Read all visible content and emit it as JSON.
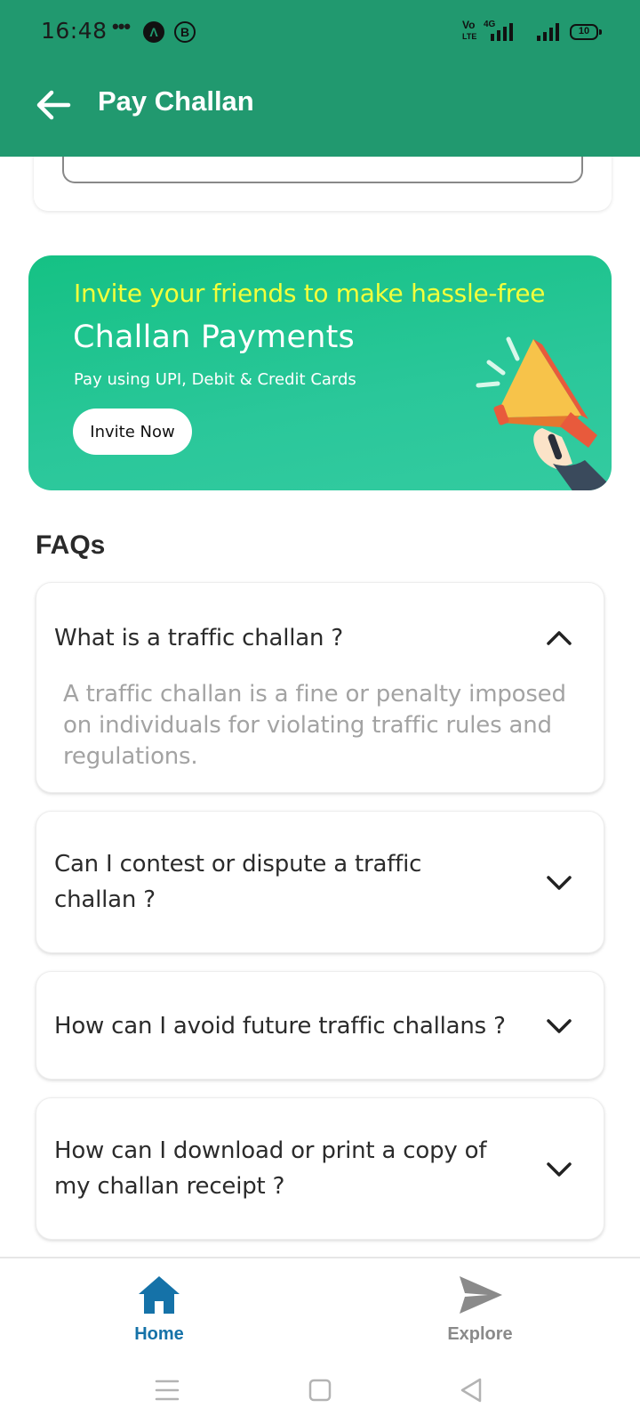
{
  "status_bar": {
    "time": "16:48",
    "dots": "•••",
    "badge_a": "Λ",
    "badge_b": "B",
    "network_1": "Vo",
    "network_2": "LTE",
    "network_3": "4G",
    "battery": "10"
  },
  "app_bar": {
    "title": "Pay Challan",
    "back_icon": "arrow-left-icon",
    "bg_color": "#21996f"
  },
  "promo": {
    "line1": "Invite your friends to make hassle-free",
    "line2": "Challan Payments",
    "line3": "Pay using UPI, Debit & Credit Cards",
    "button_label": "Invite Now",
    "illustration": "megaphone-icon"
  },
  "faqs": {
    "heading": "FAQs",
    "items": [
      {
        "question": "What is a traffic challan ?",
        "answer": "A traffic challan is a fine or penalty imposed on individuals for violating traffic rules and regulations.",
        "expanded": true,
        "icon": "chevron-up-icon"
      },
      {
        "question": "Can I contest or dispute a traffic challan ?",
        "expanded": false,
        "icon": "chevron-down-icon"
      },
      {
        "question": "How can I avoid future traffic challans ?",
        "expanded": false,
        "icon": "chevron-down-icon"
      },
      {
        "question": "How can I download or print a copy of my challan receipt ?",
        "expanded": false,
        "icon": "chevron-down-icon"
      }
    ]
  },
  "bottom_nav": {
    "items": [
      {
        "label": "Home",
        "icon": "home-icon",
        "active": true
      },
      {
        "label": "Explore",
        "icon": "send-icon",
        "active": false
      }
    ],
    "active_color": "#1572a8"
  },
  "system_nav": {
    "items": [
      "menu-icon",
      "square-icon",
      "back-triangle-icon"
    ]
  }
}
